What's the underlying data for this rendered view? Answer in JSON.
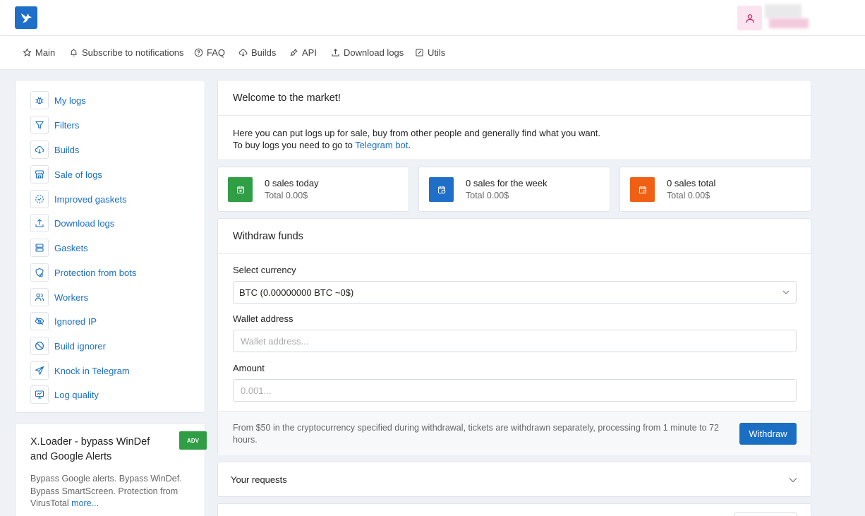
{
  "nav": {
    "items": [
      {
        "label": "Main",
        "icon": "star-icon"
      },
      {
        "label": "Subscribe to notifications",
        "icon": "bell-icon"
      },
      {
        "label": "FAQ",
        "icon": "help-circle-icon"
      },
      {
        "label": "Builds",
        "icon": "cloud-download-icon"
      },
      {
        "label": "API",
        "icon": "plug-icon"
      },
      {
        "label": "Download logs",
        "icon": "upload-icon"
      },
      {
        "label": "Utils",
        "icon": "tool-icon"
      }
    ]
  },
  "sidebar": {
    "items": [
      {
        "label": "My logs",
        "icon": "bug-icon"
      },
      {
        "label": "Filters",
        "icon": "filter-icon"
      },
      {
        "label": "Builds",
        "icon": "cloud-download-icon"
      },
      {
        "label": "Sale of logs",
        "icon": "store-icon"
      },
      {
        "label": "Improved gaskets",
        "icon": "dashed-circle-check-icon"
      },
      {
        "label": "Download logs",
        "icon": "upload-icon"
      },
      {
        "label": "Gaskets",
        "icon": "server-icon"
      },
      {
        "label": "Protection from bots",
        "icon": "shield-star-icon"
      },
      {
        "label": "Workers",
        "icon": "users-icon"
      },
      {
        "label": "Ignored IP",
        "icon": "eye-off-icon"
      },
      {
        "label": "Build ignorer",
        "icon": "ban-icon"
      },
      {
        "label": "Knock in Telegram",
        "icon": "send-icon"
      },
      {
        "label": "Log quality",
        "icon": "monitor-icon"
      }
    ]
  },
  "ad": {
    "title": "X.Loader - bypass WinDef and Google Alerts",
    "badge": "ADV",
    "description": "Bypass Google alerts. Bypass WinDef. Bypass SmartScreen. Protection from VirusTotal",
    "more": "more..."
  },
  "welcome": {
    "title": "Welcome to the market!",
    "line1": "Here you can put logs up for sale, buy from other people and generally find what you want.",
    "line2_prefix": "To buy logs you need to go to",
    "link": "Telegram bot",
    "line2_suffix": "."
  },
  "stats": [
    {
      "title": "0 sales today",
      "total": "Total 0.00$",
      "color": "#2f9e44"
    },
    {
      "title": "0 sales for the week",
      "total": "Total 0.00$",
      "color": "#1f6fc8"
    },
    {
      "title": "0 sales total",
      "total": "Total 0.00$",
      "color": "#f06014"
    }
  ],
  "withdraw": {
    "title": "Withdraw funds",
    "currency_label": "Select currency",
    "currency_value": "BTC (0.00000000 BTC ~0$)",
    "wallet_label": "Wallet address",
    "wallet_placeholder": "Wallet address...",
    "amount_label": "Amount",
    "amount_placeholder": "0.001...",
    "note": "From $50 in the cryptocurrency specified during withdrawal, tickets are withdrawn separately, processing from 1 minute to 72 hours.",
    "button": "Withdraw"
  },
  "requests": {
    "title": "Your requests"
  },
  "colors": {
    "accent": "#1b6fc2",
    "adv_badge": "#2f9e44"
  }
}
